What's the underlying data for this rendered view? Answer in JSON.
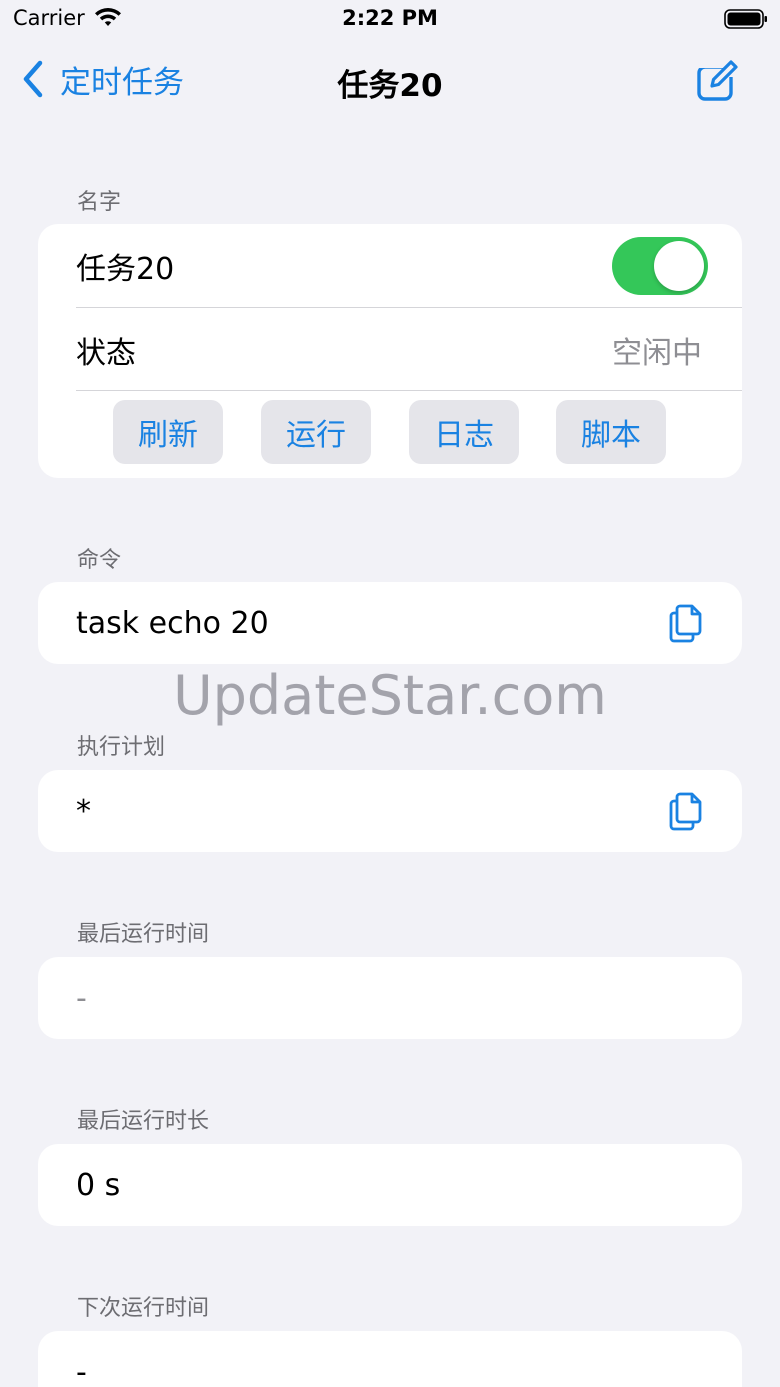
{
  "status_bar": {
    "carrier": "Carrier",
    "time": "2:22 PM"
  },
  "nav": {
    "back_label": "定时任务",
    "title": "任务20"
  },
  "sections": {
    "name_header": "名字",
    "task_name": "任务20",
    "enabled": true,
    "status_label": "状态",
    "status_value": "空闲中",
    "buttons": [
      "刷新",
      "运行",
      "日志",
      "脚本"
    ],
    "command_header": "命令",
    "command_value": "task echo 20",
    "schedule_header": "执行计划",
    "schedule_value": "*",
    "last_run_time_header": "最后运行时间",
    "last_run_time_value": "-",
    "last_run_duration_header": "最后运行时长",
    "last_run_duration_value": "0 s",
    "next_run_time_header": "下次运行时间",
    "next_run_time_value": "-"
  },
  "watermark": "UpdateStar.com",
  "colors": {
    "accent": "#1A82E2",
    "toggle_on": "#34C759",
    "background": "#F2F2F7"
  },
  "icons": {
    "back": "chevron-left-icon",
    "edit": "compose-icon",
    "copy": "copy-icon"
  }
}
